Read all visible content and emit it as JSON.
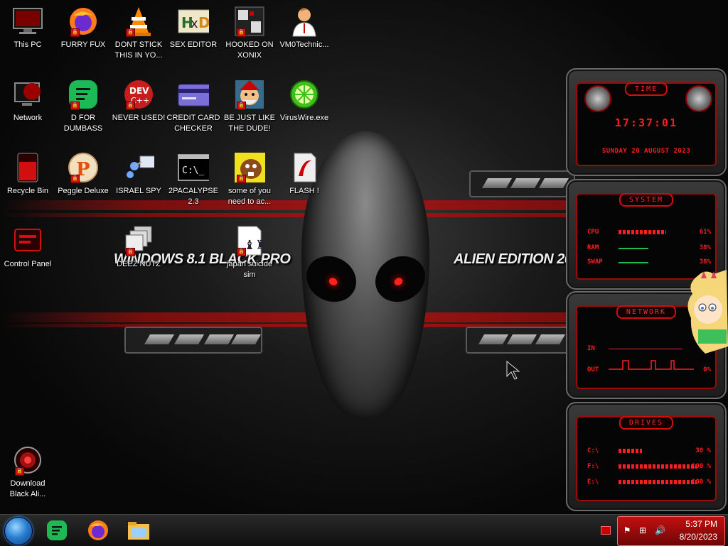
{
  "desktop": {
    "icons": [
      {
        "id": "this-pc",
        "label": "This PC"
      },
      {
        "id": "furry-fux",
        "label": "FURRY FUX"
      },
      {
        "id": "dont-stick",
        "label": "DONT STICK THIS IN YO..."
      },
      {
        "id": "sex-editor",
        "label": "SEX EDITOR"
      },
      {
        "id": "hooked-on-xonix",
        "label": "HOOKED ON XONIX"
      },
      {
        "id": "vm0technic",
        "label": "VM0Technic..."
      },
      {
        "id": "network",
        "label": "Network"
      },
      {
        "id": "d-for-dumbass",
        "label": "D FOR DUMBASS"
      },
      {
        "id": "never-used",
        "label": "NEVER USED!"
      },
      {
        "id": "credit-card-checker",
        "label": "CREDIT CARD CHECKER"
      },
      {
        "id": "be-just-like-the-dude",
        "label": "BE JUST LIKE THE DUDE!"
      },
      {
        "id": "viruswire",
        "label": "VirusWire.exe"
      },
      {
        "id": "recycle-bin",
        "label": "Recycle Bin"
      },
      {
        "id": "peggle-deluxe",
        "label": "Peggle Deluxe"
      },
      {
        "id": "israel-spy",
        "label": "ISRAEL SPY"
      },
      {
        "id": "2pacalypse",
        "label": "2PACALYPSE 2.3"
      },
      {
        "id": "some-of-you",
        "label": "some of you need to ac..."
      },
      {
        "id": "flash",
        "label": "FLASH !"
      },
      {
        "id": "control-panel",
        "label": "Control Panel"
      },
      {
        "id": "deez-nutz",
        "label": "DEEZ NUTZ"
      },
      {
        "id": "japan-suicide-sim",
        "label": "japan suicide sim"
      },
      {
        "id": "download-black-alien",
        "label": "Download Black Ali..."
      }
    ],
    "wallpaper": {
      "left_text": "WINDOWS 8.1 BLACK PRO",
      "right_text": "ALIEN EDITION 20"
    }
  },
  "gadgets": {
    "time": {
      "title": "TIME",
      "clock": "17:37:01",
      "date": "SUNDAY 20 AUGUST 2023"
    },
    "system": {
      "title": "SYSTEM",
      "rows": [
        {
          "key": "CPU",
          "value": "61%",
          "fill": 0.61
        },
        {
          "key": "RAM",
          "value": "38%",
          "fill": 0.38
        },
        {
          "key": "SWAP",
          "value": "38%",
          "fill": 0.38
        }
      ]
    },
    "network": {
      "title": "NETWORK",
      "in_label": "IN",
      "out_label": "OUT",
      "out_value": "0%"
    },
    "drives": {
      "title": "DRIVES",
      "rows": [
        {
          "key": "C:\\",
          "value": "30 %",
          "fill": 0.3
        },
        {
          "key": "F:\\",
          "value": "100 %",
          "fill": 1.0
        },
        {
          "key": "E:\\",
          "value": "100 %",
          "fill": 1.0
        }
      ]
    }
  },
  "taskbar": {
    "pinned": [
      "start-orb",
      "notes-app",
      "firefox",
      "file-explorer"
    ],
    "clock": {
      "time": "5:37 PM",
      "date": "8/20/2023"
    },
    "tray_icons": [
      "flag-icon",
      "network-icon",
      "volume-icon"
    ]
  },
  "colors": {
    "accent": "#d01010",
    "tray": "#c21010",
    "start": "#2a7fd0"
  }
}
